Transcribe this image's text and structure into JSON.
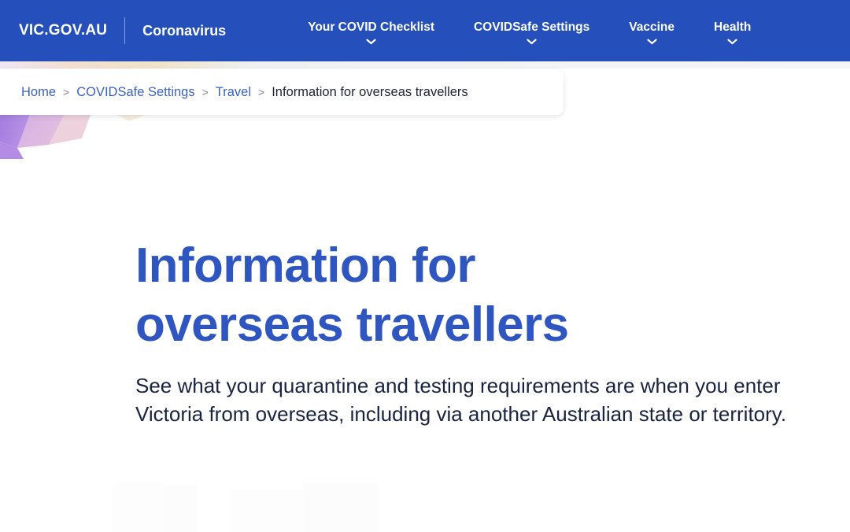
{
  "navbar": {
    "logo": "VIC.GOV.AU",
    "brand": "Coronavirus",
    "items": [
      {
        "label": "Your COVID Checklist",
        "has_chevron": true
      },
      {
        "label": "COVIDSafe Settings",
        "has_chevron": true
      },
      {
        "label": "Vaccine",
        "has_chevron": true
      },
      {
        "label": "Health",
        "has_chevron": true
      }
    ],
    "background_color": "#2550bc",
    "text_color": "#ffffff"
  },
  "breadcrumb": {
    "separator": ">",
    "items": [
      {
        "label": "Home",
        "is_current": false
      },
      {
        "label": "COVIDSafe Settings",
        "is_current": false
      },
      {
        "label": "Travel",
        "is_current": false
      },
      {
        "label": "Information for overseas travellers",
        "is_current": true
      }
    ],
    "link_color": "#3b63c4",
    "current_color": "#1d2333"
  },
  "main": {
    "title": "Information for overseas travellers",
    "subtitle": "See what your quarantine and testing requirements are when you enter Victoria from overseas, including via another Australian state or territory.",
    "title_color": "#2f56c0",
    "subtitle_color": "#1a2340"
  },
  "decoration": {
    "name": "polygonal-gradient-banner",
    "colors": [
      "#a07ae0",
      "#c9a4e8",
      "#e8c4d4",
      "#f2d9d2",
      "#f7efe2",
      "#f5ead8",
      "#ecd9b4"
    ]
  }
}
